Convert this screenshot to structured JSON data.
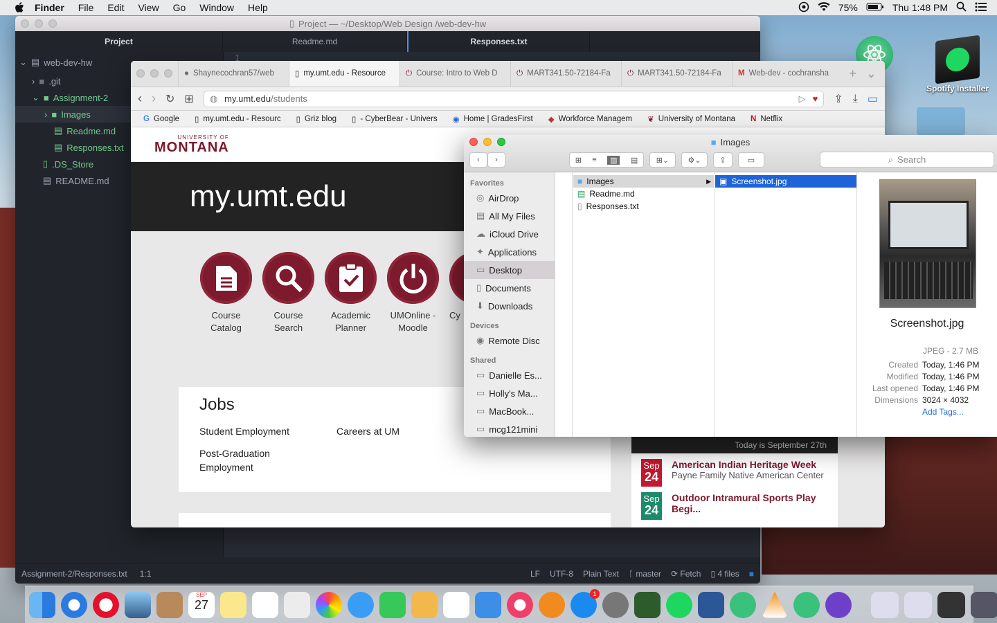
{
  "menubar": {
    "app": "Finder",
    "items": [
      "File",
      "Edit",
      "View",
      "Go",
      "Window",
      "Help"
    ],
    "battery": "75%",
    "clock": "Thu 1:48 PM"
  },
  "atom": {
    "title": "Project — ~/Desktop/Web Design /web-dev-hw",
    "tabs": [
      "Project",
      "Readme.md",
      "Responses.txt"
    ],
    "tree": {
      "root": "web-dev-hw",
      "git": ".git",
      "assignment": "Assignment-2",
      "images": "Images",
      "readme": "Readme.md",
      "responses": "Responses.txt",
      "ds_store": ".DS_Store",
      "readme_root": "README.md"
    },
    "line_number": "1",
    "status": {
      "path": "Assignment-2/Responses.txt",
      "cursor": "1:1",
      "line_ending": "LF",
      "encoding": "UTF-8",
      "grammar": "Plain Text",
      "branch": "master",
      "fetch": "Fetch",
      "files": "4 files"
    }
  },
  "safari": {
    "tabs": [
      "Shaynecochran57/web",
      "my.umt.edu - Resource",
      "Course: Intro to Web D",
      "MART341.50-72184-Fa",
      "MART341.50-72184-Fa",
      "Web-dev - cochransha"
    ],
    "url_domain": "my.umt.edu",
    "url_path": "/students",
    "bookmarks": [
      "Google",
      "my.umt.edu - Resourc",
      "Griz blog",
      "- CyberBear - Univers",
      "Home | GradesFirst",
      "Workforce Managem",
      "University of Montana",
      "Netflix"
    ],
    "logo_small": "UNIVERSITY OF",
    "logo_big": "MONTANA",
    "banner": "my.umt.edu",
    "icons": [
      {
        "line1": "Course",
        "line2": "Catalog"
      },
      {
        "line1": "Course",
        "line2": "Search"
      },
      {
        "line1": "Academic",
        "line2": "Planner"
      },
      {
        "line1": "UMOnline -",
        "line2": "Moodle"
      },
      {
        "line1": "Cy",
        "line2": ""
      }
    ],
    "jobs": {
      "heading": "Jobs",
      "links": [
        "Student Employment",
        "Careers at UM",
        "Post-Graduation Employment"
      ]
    },
    "events": {
      "today": "Today is September 27th",
      "items": [
        {
          "month": "Sep",
          "day": "24",
          "title": "American Indian Heritage Week",
          "sub": "Payne Family Native American Center"
        },
        {
          "month": "Sep",
          "day": "24",
          "title": "Outdoor Intramural Sports Play Begi...",
          "sub": ""
        }
      ]
    }
  },
  "finder": {
    "title": "Images",
    "search_placeholder": "Search",
    "favorites_header": "Favorites",
    "favorites": [
      "AirDrop",
      "All My Files",
      "iCloud Drive",
      "Applications",
      "Desktop",
      "Documents",
      "Downloads"
    ],
    "devices_header": "Devices",
    "devices": [
      "Remote Disc"
    ],
    "shared_header": "Shared",
    "shared": [
      "Danielle Es...",
      "Holly's Ma...",
      "MacBook...",
      "mcg121mini"
    ],
    "col1": [
      "Images",
      "Readme.md",
      "Responses.txt"
    ],
    "col2": [
      "Screenshot.jpg"
    ],
    "preview": {
      "name": "Screenshot.jpg",
      "kind": "JPEG - 2.7 MB",
      "created_label": "Created",
      "created": "Today, 1:46 PM",
      "modified_label": "Modified",
      "modified": "Today, 1:46 PM",
      "opened_label": "Last opened",
      "opened": "Today, 1:46 PM",
      "dims_label": "Dimensions",
      "dims": "3024 × 4032",
      "tags": "Add Tags..."
    }
  },
  "desktop": {
    "spotify": "Spotify Installer"
  },
  "dock_badge": "1",
  "calendar": {
    "month": "SEP",
    "day": "27"
  }
}
